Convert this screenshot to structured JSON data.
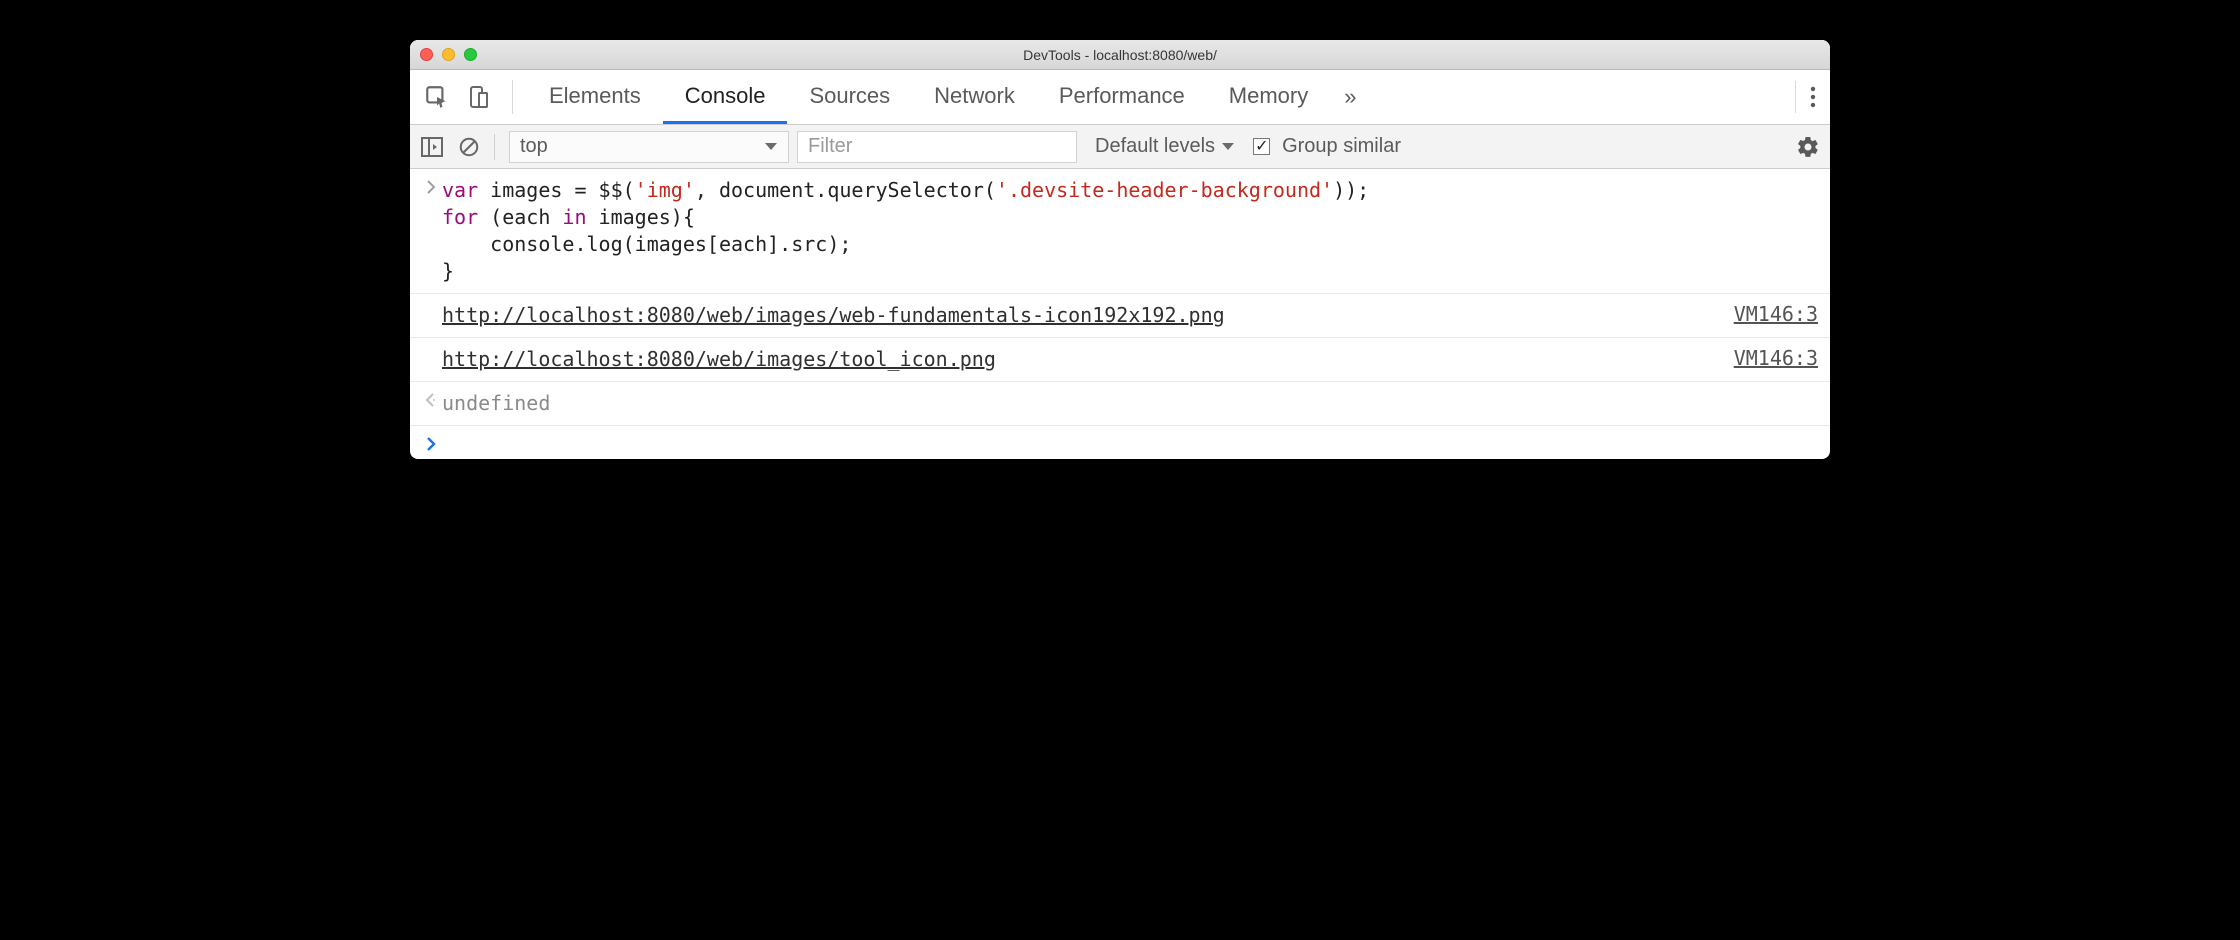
{
  "window": {
    "title": "DevTools - localhost:8080/web/"
  },
  "tabs": {
    "items": [
      "Elements",
      "Console",
      "Sources",
      "Network",
      "Performance",
      "Memory"
    ],
    "active_index": 1,
    "overflow_glyph": "»"
  },
  "toolbar": {
    "context": "top",
    "filter_placeholder": "Filter",
    "levels_label": "Default levels",
    "group_similar_label": "Group similar",
    "group_similar_checked": true
  },
  "console": {
    "input_code": {
      "line1_pre": "var",
      "line1_var": " images ",
      "line1_eq": "= $$(",
      "line1_str1": "'img'",
      "line1_mid": ", document.querySelector(",
      "line1_str2": "'.devsite-header-background'",
      "line1_end": "));",
      "line2_pre": "for",
      "line2_mid1": " (each ",
      "line2_in": "in",
      "line2_mid2": " images){",
      "line3": "    console.log(images[each].src);",
      "line4": "}"
    },
    "logs": [
      {
        "text": "http://localhost:8080/web/images/web-fundamentals-icon192x192.png",
        "source": "VM146:3"
      },
      {
        "text": "http://localhost:8080/web/images/tool_icon.png",
        "source": "VM146:3"
      }
    ],
    "return_value": "undefined"
  }
}
